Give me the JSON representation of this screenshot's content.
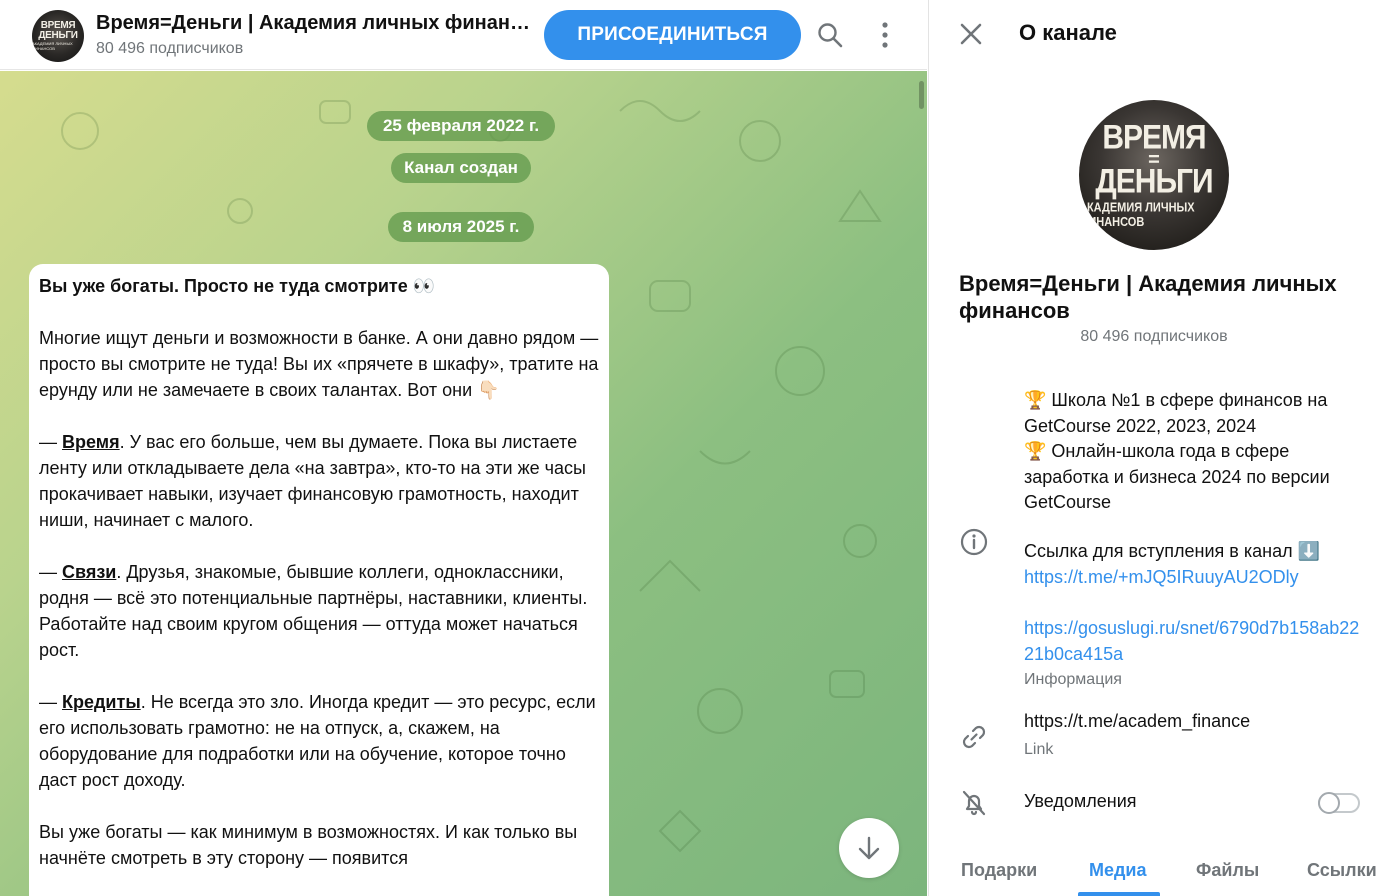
{
  "colors": {
    "accent": "#3390ec",
    "muted": "#707579",
    "chat_bg_start": "#d5dc8e",
    "chat_bg_end": "#7cb57d"
  },
  "header": {
    "avatar_line1": "ВРЕМЯ",
    "avatar_line2": "ДЕНЬГИ",
    "avatar_line3": "АКАДЕМИЯ ЛИЧНЫХ ФИНАНСОВ",
    "title": "Время=Деньги | Академия личных финансов",
    "subscribers": "80 496 подписчиков",
    "join_label": "ПРИСОЕДИНИТЬСЯ",
    "icons": [
      "search-icon",
      "more-vertical-icon"
    ]
  },
  "chat": {
    "dates": [
      "25 февраля 2022 г.",
      "Канал создан",
      "8 июля 2025 г."
    ],
    "message": {
      "lead": "Вы уже богаты. Просто не туда смотрите 👀",
      "p1": "Многие ищут деньги и возможности в банке. А они давно рядом — просто вы смотрите не туда! Вы их «прячете в шкафу», тратите на ерунду или не замечаете в своих талантах. Вот они 👇🏻",
      "p2_prefix": "— ",
      "p2_term": "Время",
      "p2_text": ". У вас его больше, чем вы думаете. Пока вы листаете ленту или откладываете дела «на завтра», кто-то на эти же часы прокачивает навыки, изучает финансовую грамотность, находит ниши, начинает с малого.",
      "p3_prefix": "— ",
      "p3_term": "Связи",
      "p3_text": ". Друзья, знакомые, бывшие коллеги, одноклассники, родня — всё это потенциальные партнёры, наставники, клиенты. Работайте над своим кругом общения — оттуда может начаться рост.",
      "p4_prefix": "— ",
      "p4_term": "Кредиты",
      "p4_text": ". Не всегда это зло. Иногда кредит — это ресурс, если его использовать грамотно: не на отпуск, а, скажем, на оборудование для подработки или на обучение, которое точно даст рост доходу.",
      "p5": "Вы уже богаты — как минимум в возможностях. И как только вы начнёте смотреть в эту сторону — появится"
    }
  },
  "panel": {
    "title": "О канале",
    "avatar_big1": "ВРЕМЯ",
    "avatar_eq": "=",
    "avatar_big2": "ДЕНЬГИ",
    "avatar_small": "АКАДЕМИЯ ЛИЧНЫХ ФИНАНСОВ",
    "channel_name": "Время=Деньги | Академия личных финансов",
    "subscribers": "80 496 подписчиков",
    "desc_line1": "🏆 Школа №1 в сфере финансов на GetCourse 2022, 2023, 2024",
    "desc_line2": "🏆 Онлайн-школа года в сфере заработка и бизнеса 2024 по версии GetCourse",
    "join_text": "Ссылка для вступления в канал ⬇️",
    "join_link": "https://t.me/+mJQ5IRuuyAU2ODly",
    "gos_link": "https://gosuslugi.ru/snet/6790d7b158ab2221b0ca415a",
    "info_caption": "Информация",
    "tme_link": "https://t.me/academ_finance",
    "link_caption": "Link",
    "notif_label": "Уведомления",
    "notif_on": false,
    "tabs": [
      "Подарки",
      "Медиа",
      "Файлы",
      "Ссылки"
    ],
    "active_tab": "Медиа"
  }
}
